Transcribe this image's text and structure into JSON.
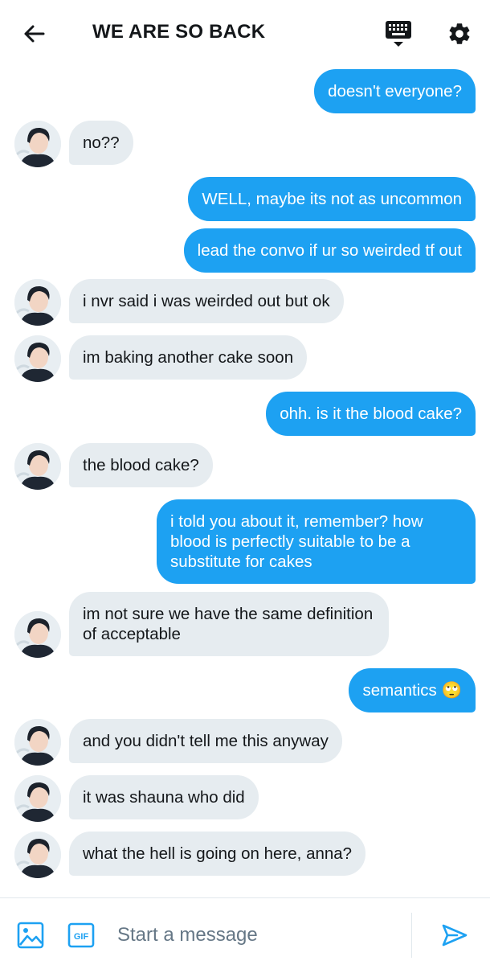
{
  "header": {
    "title": "WE ARE SO BACK",
    "icons": {
      "back": "arrow-left-icon",
      "keyboard": "keyboard-icon",
      "settings": "gear-icon"
    }
  },
  "colors": {
    "sent_bubble": "#1da1f2",
    "received_bubble": "#e6ecf0",
    "text_dark": "#14171a",
    "placeholder": "#657786"
  },
  "messages": [
    {
      "from": "me",
      "text": "doesn't everyone?"
    },
    {
      "from": "them",
      "text": "no??"
    },
    {
      "from": "me",
      "text": "WELL, maybe its not as uncommon"
    },
    {
      "from": "me",
      "text": "lead the convo if ur so weirded tf out"
    },
    {
      "from": "them",
      "text": "i nvr said i was weirded out but ok"
    },
    {
      "from": "them",
      "text": "im baking another cake soon"
    },
    {
      "from": "me",
      "text": "ohh. is it the blood cake?"
    },
    {
      "from": "them",
      "text": "the blood cake?"
    },
    {
      "from": "me",
      "text": "i told you about it, remember? how blood is perfectly suitable to be a substitute for cakes"
    },
    {
      "from": "them",
      "text": "im not sure we have the same definition of acceptable"
    },
    {
      "from": "me",
      "text": "semantics 🙄"
    },
    {
      "from": "them",
      "text": "and you didn't tell me this anyway"
    },
    {
      "from": "them",
      "text": "it was shauna who did"
    },
    {
      "from": "them",
      "text": "what the hell is going on here, anna?"
    }
  ],
  "composer": {
    "placeholder": "Start a message",
    "gif_label": "GIF",
    "icons": {
      "media": "image-icon",
      "gif": "gif-icon",
      "send": "send-icon"
    }
  }
}
